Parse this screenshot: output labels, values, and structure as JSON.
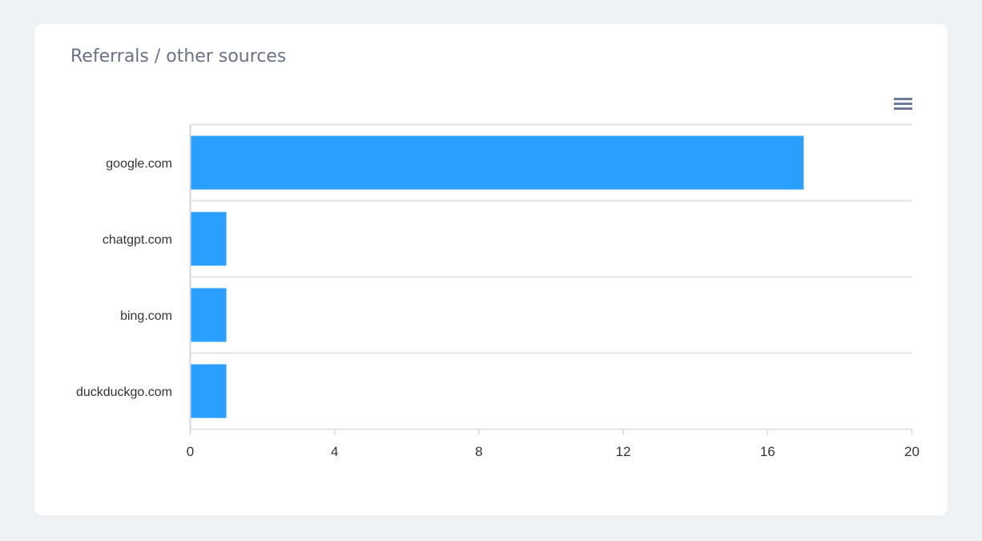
{
  "card": {
    "title": "Referrals / other sources"
  },
  "menu": {
    "icon": "hamburger-menu-icon"
  },
  "colors": {
    "bar": "#2b9fff",
    "background": "#eff2f5",
    "card": "#ffffff",
    "title": "#6b7188",
    "grid": "#e3e3e3"
  },
  "chart_data": {
    "type": "bar",
    "orientation": "horizontal",
    "title": "Referrals / other sources",
    "categories": [
      "google.com",
      "chatgpt.com",
      "bing.com",
      "duckduckgo.com"
    ],
    "values": [
      17,
      1,
      1,
      1
    ],
    "xlim": [
      0,
      20
    ],
    "xticks": [
      0,
      4,
      8,
      12,
      16,
      20
    ],
    "xlabel": "",
    "ylabel": "",
    "grid": true,
    "legend": "none"
  }
}
